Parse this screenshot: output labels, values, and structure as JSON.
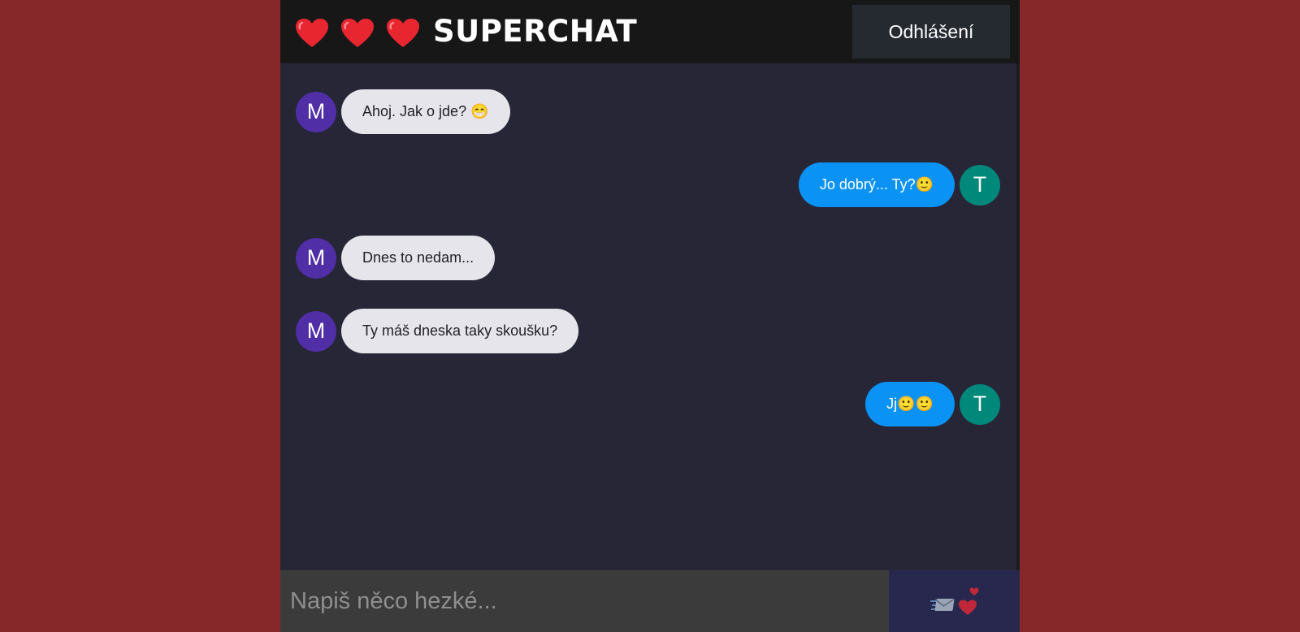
{
  "header": {
    "title": "SUPERCHAT",
    "hearts": [
      "heart-icon",
      "heart-icon",
      "heart-icon"
    ],
    "logout_label": "Odhlášení"
  },
  "messages": [
    {
      "side": "left",
      "avatar": "M",
      "avatar_color": "#4f2ea6",
      "text": "Ahoj. Jak o jde? 😁"
    },
    {
      "side": "right",
      "avatar": "T",
      "avatar_color": "#00897b",
      "text": "Jo dobrý... Ty?🙂"
    },
    {
      "side": "left",
      "avatar": "M",
      "avatar_color": "#4f2ea6",
      "text": "Dnes to nedam..."
    },
    {
      "side": "left",
      "avatar": "M",
      "avatar_color": "#4f2ea6",
      "text": "Ty máš dneska taky skoušku?"
    },
    {
      "side": "right",
      "avatar": "T",
      "avatar_color": "#00897b",
      "text": "Jj🙂🙂"
    }
  ],
  "composer": {
    "placeholder": "Napiš něco hezké...",
    "send_icon": "send-love-letter-icon"
  },
  "colors": {
    "page_bg": "#862829",
    "chat_bg": "#272637",
    "header_bg": "#181718",
    "incoming_bubble": "#e6e5ec",
    "outgoing_bubble": "#0a93f5",
    "send_bg": "#28284f"
  }
}
